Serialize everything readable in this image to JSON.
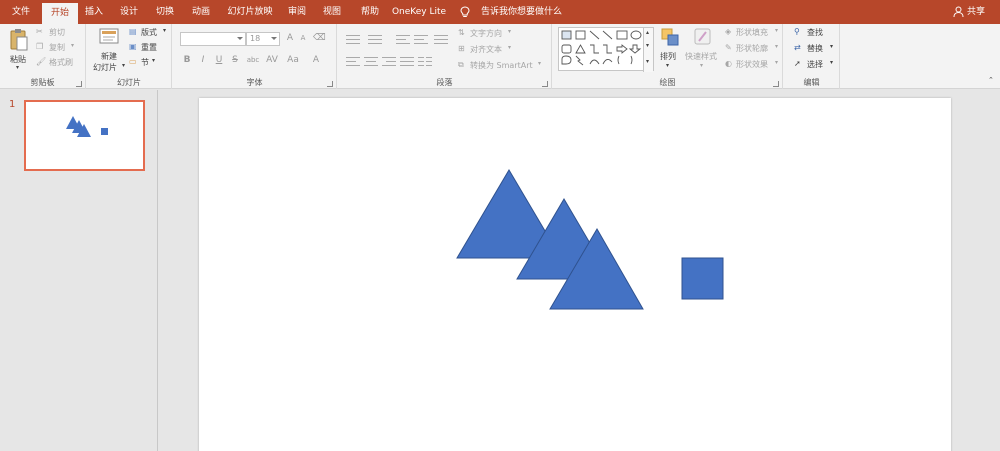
{
  "menu": {
    "tabs": [
      "文件",
      "开始",
      "插入",
      "设计",
      "切换",
      "动画",
      "幻灯片放映",
      "审阅",
      "视图",
      "帮助",
      "OneKey Lite"
    ],
    "active_tab": "开始",
    "tell_me": "告诉我你想要做什么",
    "share": "共享"
  },
  "ribbon": {
    "clipboard": {
      "label": "剪贴板",
      "paste": "粘贴",
      "cut": "剪切",
      "copy": "复制",
      "format_painter": "格式刷"
    },
    "slides": {
      "label": "幻灯片",
      "new_slide_1": "新建",
      "new_slide_2": "幻灯片",
      "layout": "版式",
      "reset": "重置",
      "section": "节"
    },
    "font": {
      "label": "字体",
      "font_name": "",
      "font_size": "18",
      "bold": "B",
      "italic": "I",
      "underline": "U",
      "strike": "S",
      "shadow": "abc",
      "spacing": "AV",
      "case": "Aa",
      "color": "A",
      "grow": "A",
      "shrink": "A"
    },
    "paragraph": {
      "label": "段落",
      "text_direction": "文字方向",
      "align_text": "对齐文本",
      "smartart": "转换为 SmartArt"
    },
    "drawing": {
      "label": "绘图",
      "arrange": "排列",
      "quick_styles": "快速样式",
      "shape_fill": "形状填充",
      "shape_outline": "形状轮廓",
      "shape_effects": "形状效果"
    },
    "editing": {
      "label": "编辑",
      "find": "查找",
      "replace": "替换",
      "select": "选择"
    }
  },
  "slides_panel": {
    "slide_number": "1"
  },
  "colors": {
    "accent": "#b7472a",
    "shape_fill": "#4472c4",
    "shape_stroke": "#2f528f",
    "thumb_border": "#e46c4f"
  },
  "slide": {
    "shapes": [
      "triangle",
      "triangle",
      "triangle",
      "square"
    ]
  }
}
